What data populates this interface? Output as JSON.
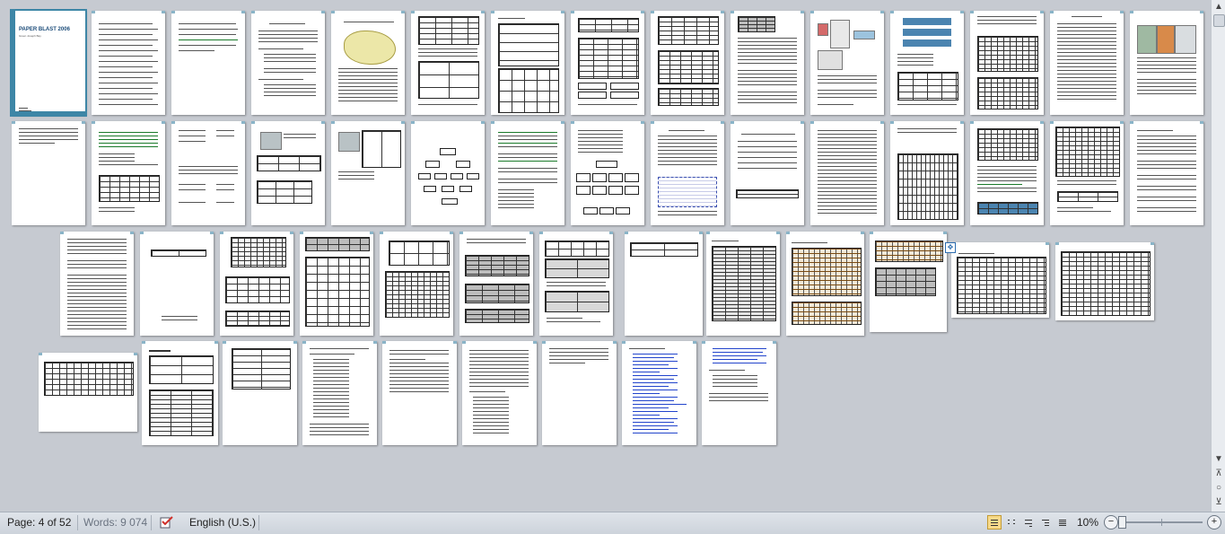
{
  "document": {
    "cover_title": "PAPER BLAST 2006",
    "cover_subtitle": "Green Joseph Bay"
  },
  "status_bar": {
    "page_info": "Page: 4 of 52",
    "words": "Words: 9 074",
    "proofing_icon": "proofing-check-icon",
    "language": "English (U.S.)",
    "zoom_percent": "10%",
    "zoom_out_symbol": "−",
    "zoom_in_symbol": "+"
  },
  "view_buttons": [
    "print-layout",
    "full-screen-reading",
    "web-layout",
    "outline",
    "draft"
  ],
  "scrollbar": {
    "up_symbol": "▲",
    "down_symbol": "▼",
    "prev_symbol": "⊼",
    "select_symbol": "○",
    "next_symbol": "⊻"
  },
  "colors": {
    "workspace": "#c6cad1",
    "selection_outline": "#3d86a6",
    "active_view": "#f7d98a"
  }
}
